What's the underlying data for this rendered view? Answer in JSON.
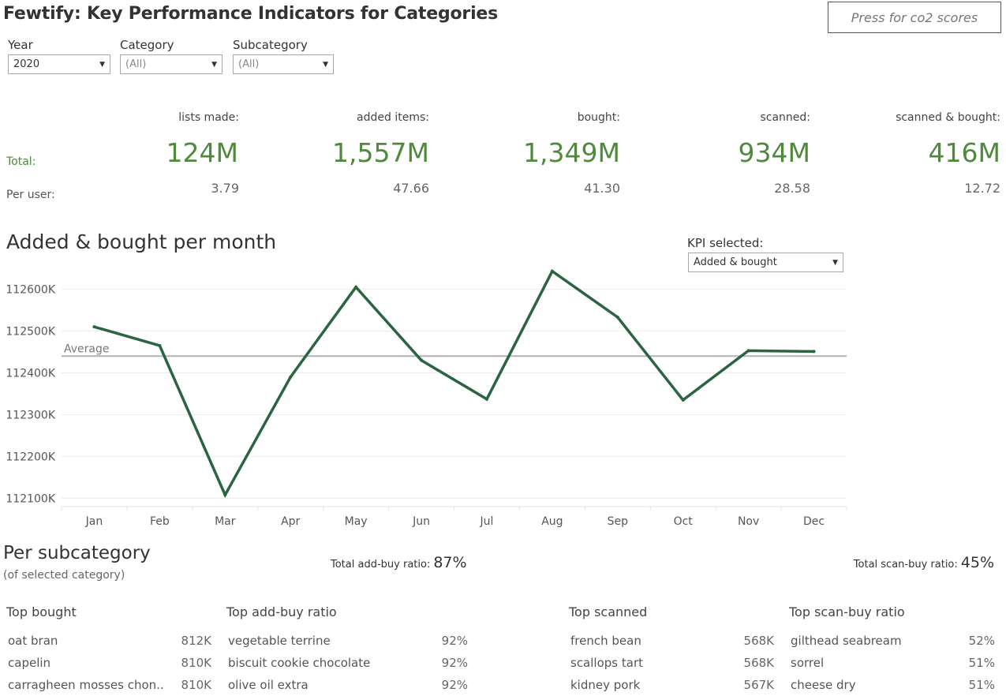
{
  "title": "Fewtify: Key Performance Indicators for Categories",
  "co2_button": "Press for co2 scores",
  "filters": {
    "year": {
      "label": "Year",
      "value": "2020"
    },
    "category": {
      "label": "Category",
      "value": "(All)"
    },
    "subcategory": {
      "label": "Subcategory",
      "value": "(All)"
    }
  },
  "kpis": {
    "row_total": "Total:",
    "row_per_user": "Per user:",
    "items": [
      {
        "label": "lists made:",
        "total": "124M",
        "per_user": "3.79"
      },
      {
        "label": "added items:",
        "total": "1,557M",
        "per_user": "47.66"
      },
      {
        "label": "bought:",
        "total": "1,349M",
        "per_user": "41.30"
      },
      {
        "label": "scanned:",
        "total": "934M",
        "per_user": "28.58"
      },
      {
        "label": "scanned & bought:",
        "total": "416M",
        "per_user": "12.72"
      }
    ]
  },
  "chart_title": "Added & bought per month",
  "kpi_selector": {
    "label": "KPI selected:",
    "value": "Added & bought"
  },
  "chart_data": {
    "type": "line",
    "title": "Added & bought per month",
    "categories": [
      "Jan",
      "Feb",
      "Mar",
      "Apr",
      "May",
      "Jun",
      "Jul",
      "Aug",
      "Sep",
      "Oct",
      "Nov",
      "Dec"
    ],
    "values": [
      112510,
      112465,
      112108,
      112390,
      112605,
      112430,
      112337,
      112643,
      112533,
      112335,
      112453,
      112451
    ],
    "y_ticks": [
      112100,
      112200,
      112300,
      112400,
      112500,
      112600
    ],
    "y_tick_labels": [
      "112100K",
      "112200K",
      "112300K",
      "112400K",
      "112500K",
      "112600K"
    ],
    "ylim": [
      112080,
      112650
    ],
    "average": 112440,
    "average_label": "Average",
    "line_color": "#2b6440",
    "average_color": "#b3b3b3",
    "grid": true
  },
  "subcategory": {
    "title": "Per subcategory",
    "note": "(of selected category)",
    "add_buy_label": "Total  add-buy ratio:",
    "add_buy_value": "87%",
    "scan_buy_label": "Total scan-buy ratio:",
    "scan_buy_value": "45%",
    "lists": [
      {
        "heading": "Top bought",
        "rows": [
          {
            "name": "oat bran",
            "value": "812K"
          },
          {
            "name": "capelin",
            "value": "810K"
          },
          {
            "name": "carragheen mosses chon..",
            "value": "810K"
          }
        ]
      },
      {
        "heading": "Top add-buy ratio",
        "rows": [
          {
            "name": "vegetable terrine",
            "value": "92%"
          },
          {
            "name": "biscuit cookie chocolate",
            "value": "92%"
          },
          {
            "name": "olive oil extra",
            "value": "92%"
          }
        ]
      },
      {
        "heading": "Top scanned",
        "rows": [
          {
            "name": "french bean",
            "value": "568K"
          },
          {
            "name": "scallops tart",
            "value": "568K"
          },
          {
            "name": "kidney pork",
            "value": "567K"
          }
        ]
      },
      {
        "heading": "Top scan-buy ratio",
        "rows": [
          {
            "name": "gilthead seabream",
            "value": "52%"
          },
          {
            "name": "sorrel",
            "value": "51%"
          },
          {
            "name": "cheese dry",
            "value": "51%"
          }
        ]
      }
    ]
  }
}
